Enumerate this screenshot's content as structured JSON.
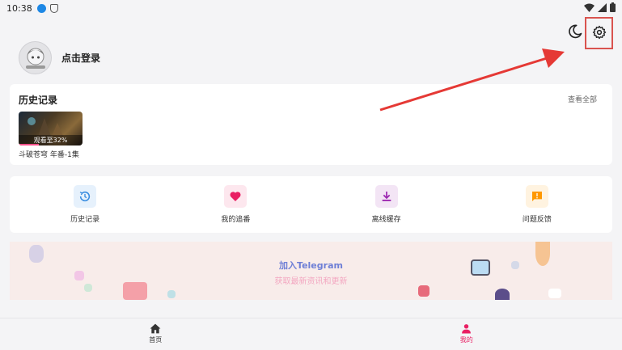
{
  "status_bar": {
    "time": "10:38",
    "icons": [
      "app-badge-icon",
      "shield-icon",
      "wifi-icon",
      "signal-icon",
      "battery-icon"
    ]
  },
  "topbar": {
    "icons": [
      "moon-icon",
      "gear-icon"
    ]
  },
  "profile": {
    "login_text": "点击登录"
  },
  "history": {
    "title": "历史记录",
    "view_all": "查看全部",
    "items": [
      {
        "overlay_text": "观看至32%",
        "title": "斗破苍穹 年番-1集",
        "progress": 0.32
      }
    ]
  },
  "actions": [
    {
      "label": "历史记录",
      "icon": "history-icon",
      "color": "#3a8de0",
      "bg": "#e6f1fc"
    },
    {
      "label": "我的追番",
      "icon": "heart-icon",
      "color": "#e91e63",
      "bg": "#fde7ee"
    },
    {
      "label": "离线缓存",
      "icon": "download-icon",
      "color": "#9c27b0",
      "bg": "#f3e5f5"
    },
    {
      "label": "问题反馈",
      "icon": "feedback-icon",
      "color": "#ff9800",
      "bg": "#fff3e0"
    }
  ],
  "banner": {
    "title": "加入Telegram",
    "subtitle": "获取最新资讯和更新"
  },
  "bottom_nav": [
    {
      "label": "首页",
      "icon": "home-icon",
      "active": false
    },
    {
      "label": "我的",
      "icon": "person-icon",
      "active": true
    }
  ],
  "colors": {
    "accent": "#e91e63",
    "highlight_box": "#d9534f",
    "arrow": "#e53935"
  }
}
